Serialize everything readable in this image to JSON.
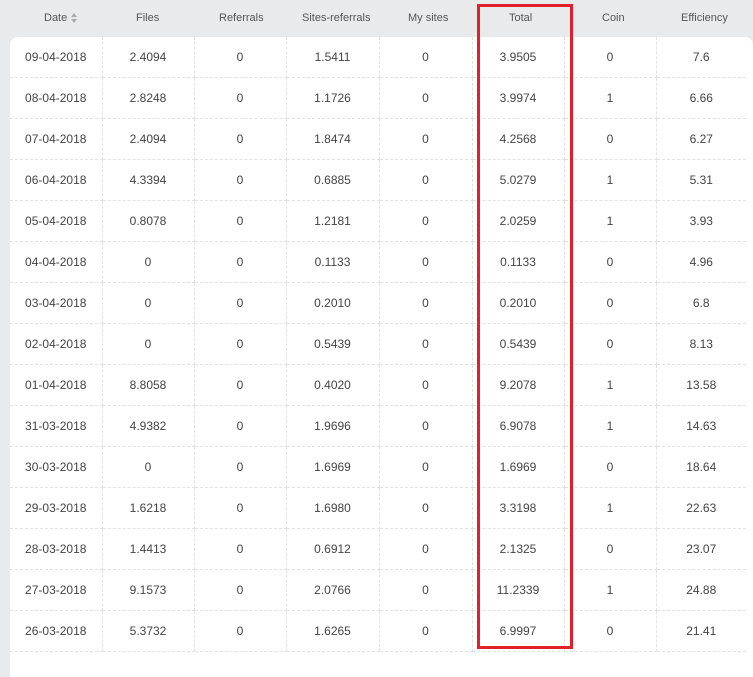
{
  "table": {
    "headers": [
      "Date",
      "Files",
      "Referrals",
      "Sites-referrals",
      "My sites",
      "Total",
      "Coin",
      "Efficiency"
    ],
    "rows": [
      [
        "09-04-2018",
        "2.4094",
        "0",
        "1.5411",
        "0",
        "3.9505",
        "0",
        "7.6"
      ],
      [
        "08-04-2018",
        "2.8248",
        "0",
        "1.1726",
        "0",
        "3.9974",
        "1",
        "6.66"
      ],
      [
        "07-04-2018",
        "2.4094",
        "0",
        "1.8474",
        "0",
        "4.2568",
        "0",
        "6.27"
      ],
      [
        "06-04-2018",
        "4.3394",
        "0",
        "0.6885",
        "0",
        "5.0279",
        "1",
        "5.31"
      ],
      [
        "05-04-2018",
        "0.8078",
        "0",
        "1.2181",
        "0",
        "2.0259",
        "1",
        "3.93"
      ],
      [
        "04-04-2018",
        "0",
        "0",
        "0.1133",
        "0",
        "0.1133",
        "0",
        "4.96"
      ],
      [
        "03-04-2018",
        "0",
        "0",
        "0.2010",
        "0",
        "0.2010",
        "0",
        "6.8"
      ],
      [
        "02-04-2018",
        "0",
        "0",
        "0.5439",
        "0",
        "0.5439",
        "0",
        "8.13"
      ],
      [
        "01-04-2018",
        "8.8058",
        "0",
        "0.4020",
        "0",
        "9.2078",
        "1",
        "13.58"
      ],
      [
        "31-03-2018",
        "4.9382",
        "0",
        "1.9696",
        "0",
        "6.9078",
        "1",
        "14.63"
      ],
      [
        "30-03-2018",
        "0",
        "0",
        "1.6969",
        "0",
        "1.6969",
        "0",
        "18.64"
      ],
      [
        "29-03-2018",
        "1.6218",
        "0",
        "1.6980",
        "0",
        "3.3198",
        "1",
        "22.63"
      ],
      [
        "28-03-2018",
        "1.4413",
        "0",
        "0.6912",
        "0",
        "2.1325",
        "0",
        "23.07"
      ],
      [
        "27-03-2018",
        "9.1573",
        "0",
        "2.0766",
        "0",
        "11.2339",
        "1",
        "24.88"
      ],
      [
        "26-03-2018",
        "5.3732",
        "0",
        "1.6265",
        "0",
        "6.9997",
        "0",
        "21.41"
      ]
    ]
  },
  "highlight_color": "#e0202a",
  "icons": {
    "sort": "sort-icon"
  }
}
